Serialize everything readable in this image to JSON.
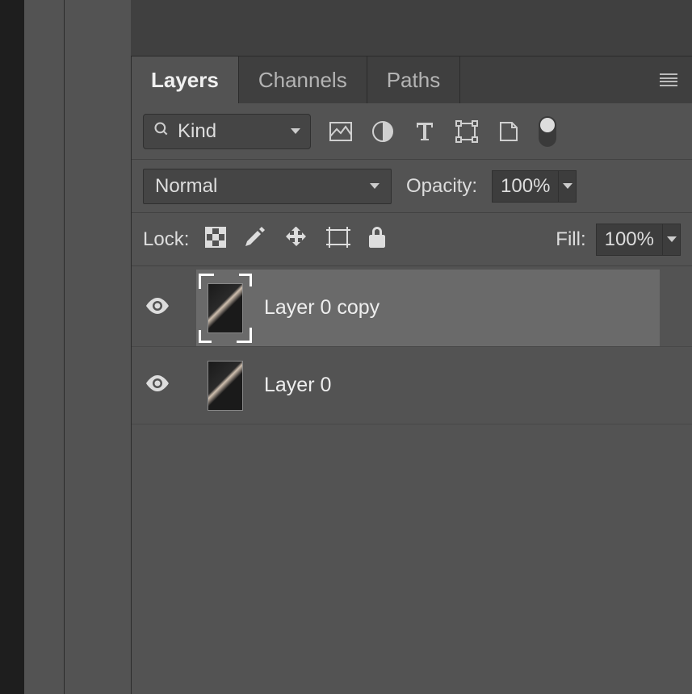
{
  "tabs": {
    "layers": "Layers",
    "channels": "Channels",
    "paths": "Paths"
  },
  "filter": {
    "kind_label": "Kind"
  },
  "blend": {
    "mode": "Normal",
    "opacity_label": "Opacity:",
    "opacity_value": "100%"
  },
  "lock": {
    "label": "Lock:",
    "fill_label": "Fill:",
    "fill_value": "100%"
  },
  "layers": [
    {
      "name": "Layer 0 copy",
      "visible": true,
      "selected": true
    },
    {
      "name": "Layer 0",
      "visible": true,
      "selected": false
    }
  ]
}
